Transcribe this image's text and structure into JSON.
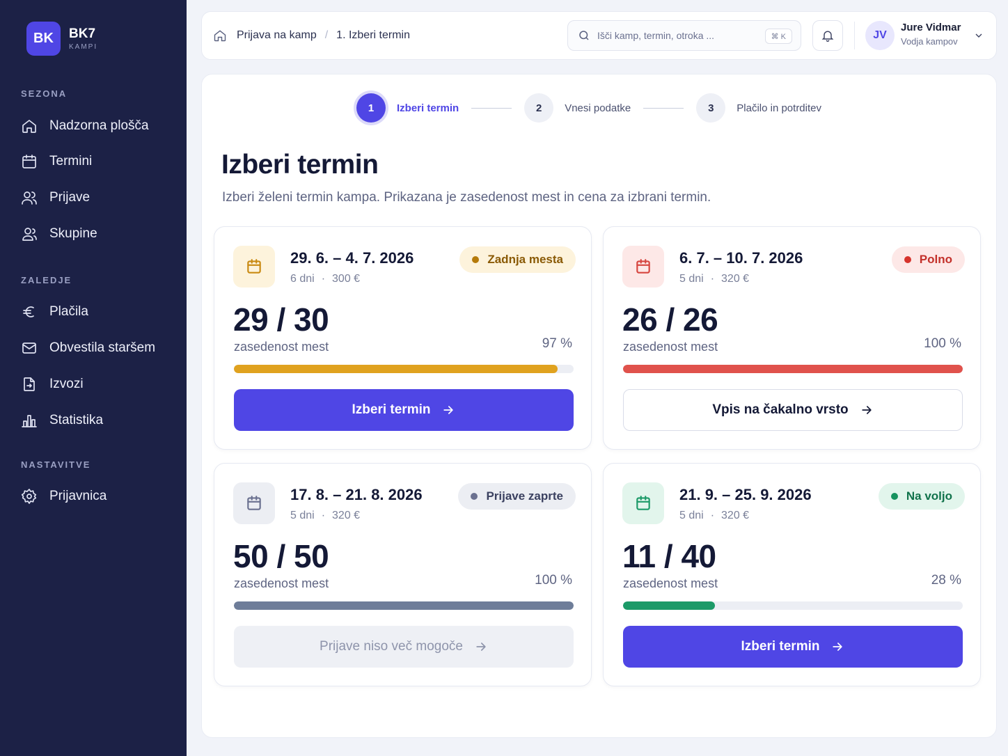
{
  "brand": {
    "logo": "BK",
    "name": "BK7",
    "sub": "KAMPI"
  },
  "sidebar": {
    "sections": [
      {
        "label": "SEZONA",
        "items": [
          {
            "label": "Nadzorna plošča",
            "icon": "home-icon"
          },
          {
            "label": "Termini",
            "icon": "calendar-icon"
          },
          {
            "label": "Prijave",
            "icon": "users-icon"
          },
          {
            "label": "Skupine",
            "icon": "group-icon"
          }
        ]
      },
      {
        "label": "ZALEDJE",
        "items": [
          {
            "label": "Plačila",
            "icon": "euro-icon"
          },
          {
            "label": "Obvestila staršem",
            "icon": "mail-icon"
          },
          {
            "label": "Izvozi",
            "icon": "file-export-icon"
          },
          {
            "label": "Statistika",
            "icon": "chart-icon"
          }
        ]
      },
      {
        "label": "NASTAVITVE",
        "items": [
          {
            "label": "Prijavnica",
            "icon": "gear-icon"
          }
        ]
      }
    ]
  },
  "topbar": {
    "breadcrumb": [
      "Prijava na kamp",
      "/",
      "1. Izberi termin"
    ],
    "search_placeholder": "Išči kamp, termin, otroka ...",
    "shortcut": "⌘ K",
    "user": {
      "initials": "JV",
      "name": "Jure Vidmar",
      "role": "Vodja kampov"
    }
  },
  "stepper": [
    {
      "num": "1",
      "label": "Izberi termin",
      "active": true
    },
    {
      "num": "2",
      "label": "Vnesi podatke",
      "active": false
    },
    {
      "num": "3",
      "label": "Plačilo in potrditev",
      "active": false
    }
  ],
  "page": {
    "title": "Izberi termin",
    "subtitle": "Izberi želeni termin kampa. Prikazana je zasedenost mest in cena za izbrani termin."
  },
  "cards": [
    {
      "date": "29. 6. – 4. 7. 2026",
      "days": "6 dni",
      "dot": "·",
      "price": "300 €",
      "badge": "Zadnja mesta",
      "occupancy": "29 / 30",
      "occ_label": "zasedenost mest",
      "percent": "97 %",
      "fill": 0.953,
      "button": "Izberi termin",
      "variant": "primary",
      "colors": {
        "accent": "#e0a21f",
        "badge_bg": "#fdf3dc",
        "badge_text": "#8a5a06",
        "badge_dot": "#b57a0a",
        "cal_bg": "#fdf3dc",
        "cal_stroke": "#c98a12"
      }
    },
    {
      "date": "6. 7. – 10. 7. 2026",
      "days": "5 dni",
      "dot": "·",
      "price": "320 €",
      "badge": "Polno",
      "occupancy": "26 / 26",
      "occ_label": "zasedenost mest",
      "percent": "100 %",
      "fill": 1.0,
      "button": "Vpis na čakalno vrsto",
      "variant": "outline",
      "colors": {
        "accent": "#e0524c",
        "badge_bg": "#fde8e7",
        "badge_text": "#c3302a",
        "badge_dot": "#d6332c",
        "cal_bg": "#fde8e7",
        "cal_stroke": "#d6453f"
      }
    },
    {
      "date": "17. 8. – 21. 8. 2026",
      "days": "5 dni",
      "dot": "·",
      "price": "320 €",
      "badge": "Prijave zaprte",
      "occupancy": "50 / 50",
      "occ_label": "zasedenost mest",
      "percent": "100 %",
      "fill": 1.0,
      "button": "Prijave niso več mogoče",
      "variant": "disabled",
      "colors": {
        "accent": "#6e7d99",
        "badge_bg": "#eceef3",
        "badge_text": "#3b4160",
        "badge_dot": "#6b7190",
        "cal_bg": "#eceef3",
        "cal_stroke": "#6b7190"
      }
    },
    {
      "date": "21. 9. – 25. 9. 2026",
      "days": "5 dni",
      "dot": "·",
      "price": "320 €",
      "badge": "Na voljo",
      "occupancy": "11 / 40",
      "occ_label": "zasedenost mest",
      "percent": "28 %",
      "fill": 0.27,
      "button": "Izberi termin",
      "variant": "primary",
      "colors": {
        "accent": "#1c9a68",
        "badge_bg": "#e2f5ec",
        "badge_text": "#11724b",
        "badge_dot": "#17925f",
        "cal_bg": "#e2f5ec",
        "cal_stroke": "#1c9a68"
      }
    }
  ]
}
